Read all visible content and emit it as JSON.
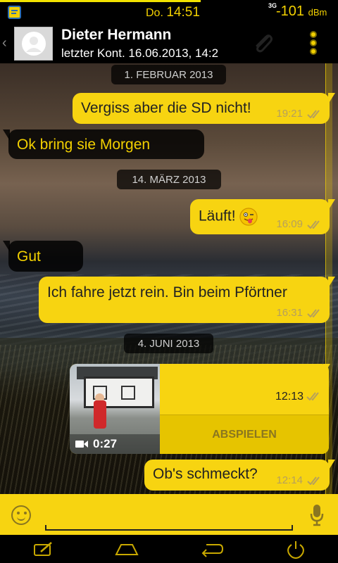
{
  "status_bar": {
    "day": "Do.",
    "time": "14:51",
    "network": "3G",
    "signal_value": "-101",
    "signal_unit": "dBm"
  },
  "header": {
    "contact_name": "Dieter Hermann",
    "contact_status": "letzter Kont. 16.06.2013, 14:2"
  },
  "messages": {
    "date1": "1. FEBRUAR 2013",
    "m1_text": "Vergiss aber die SD nicht!",
    "m1_time": "19:21",
    "m2_text": "Ok bring sie Morgen",
    "date2": "14. MÄRZ 2013",
    "m3_text": "Läuft!",
    "m3_time": "16:09",
    "m4_text": "Gut",
    "m5_text": "Ich fahre jetzt rein. Bin beim Pförtner",
    "m5_time": "16:31",
    "date3": "4. JUNI 2013",
    "video_duration": "0:27",
    "video_time": "12:13",
    "video_play_label": "ABSPIELEN",
    "m7_text": "Ob's schmeckt?",
    "m7_time": "12:14"
  },
  "composer": {
    "placeholder": ""
  },
  "colors": {
    "accent": "#f7d411",
    "accent_text": "#f2d000",
    "background": "#000000"
  }
}
